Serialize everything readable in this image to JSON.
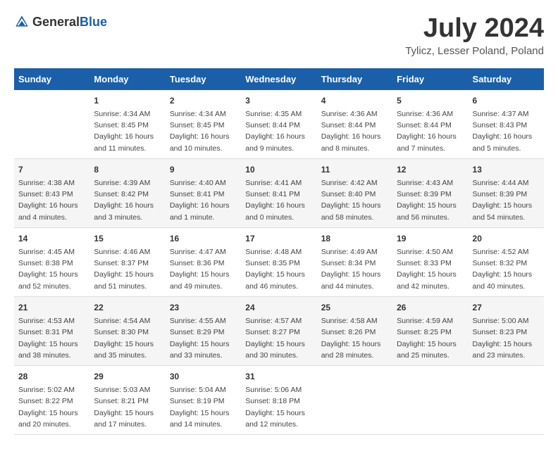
{
  "header": {
    "logo_general": "General",
    "logo_blue": "Blue",
    "month": "July 2024",
    "location": "Tylicz, Lesser Poland, Poland"
  },
  "weekdays": [
    "Sunday",
    "Monday",
    "Tuesday",
    "Wednesday",
    "Thursday",
    "Friday",
    "Saturday"
  ],
  "weeks": [
    [
      {
        "day": "",
        "sunrise": "",
        "sunset": "",
        "daylight": ""
      },
      {
        "day": "1",
        "sunrise": "Sunrise: 4:34 AM",
        "sunset": "Sunset: 8:45 PM",
        "daylight": "Daylight: 16 hours and 11 minutes."
      },
      {
        "day": "2",
        "sunrise": "Sunrise: 4:34 AM",
        "sunset": "Sunset: 8:45 PM",
        "daylight": "Daylight: 16 hours and 10 minutes."
      },
      {
        "day": "3",
        "sunrise": "Sunrise: 4:35 AM",
        "sunset": "Sunset: 8:44 PM",
        "daylight": "Daylight: 16 hours and 9 minutes."
      },
      {
        "day": "4",
        "sunrise": "Sunrise: 4:36 AM",
        "sunset": "Sunset: 8:44 PM",
        "daylight": "Daylight: 16 hours and 8 minutes."
      },
      {
        "day": "5",
        "sunrise": "Sunrise: 4:36 AM",
        "sunset": "Sunset: 8:44 PM",
        "daylight": "Daylight: 16 hours and 7 minutes."
      },
      {
        "day": "6",
        "sunrise": "Sunrise: 4:37 AM",
        "sunset": "Sunset: 8:43 PM",
        "daylight": "Daylight: 16 hours and 5 minutes."
      }
    ],
    [
      {
        "day": "7",
        "sunrise": "Sunrise: 4:38 AM",
        "sunset": "Sunset: 8:43 PM",
        "daylight": "Daylight: 16 hours and 4 minutes."
      },
      {
        "day": "8",
        "sunrise": "Sunrise: 4:39 AM",
        "sunset": "Sunset: 8:42 PM",
        "daylight": "Daylight: 16 hours and 3 minutes."
      },
      {
        "day": "9",
        "sunrise": "Sunrise: 4:40 AM",
        "sunset": "Sunset: 8:41 PM",
        "daylight": "Daylight: 16 hours and 1 minute."
      },
      {
        "day": "10",
        "sunrise": "Sunrise: 4:41 AM",
        "sunset": "Sunset: 8:41 PM",
        "daylight": "Daylight: 16 hours and 0 minutes."
      },
      {
        "day": "11",
        "sunrise": "Sunrise: 4:42 AM",
        "sunset": "Sunset: 8:40 PM",
        "daylight": "Daylight: 15 hours and 58 minutes."
      },
      {
        "day": "12",
        "sunrise": "Sunrise: 4:43 AM",
        "sunset": "Sunset: 8:39 PM",
        "daylight": "Daylight: 15 hours and 56 minutes."
      },
      {
        "day": "13",
        "sunrise": "Sunrise: 4:44 AM",
        "sunset": "Sunset: 8:39 PM",
        "daylight": "Daylight: 15 hours and 54 minutes."
      }
    ],
    [
      {
        "day": "14",
        "sunrise": "Sunrise: 4:45 AM",
        "sunset": "Sunset: 8:38 PM",
        "daylight": "Daylight: 15 hours and 52 minutes."
      },
      {
        "day": "15",
        "sunrise": "Sunrise: 4:46 AM",
        "sunset": "Sunset: 8:37 PM",
        "daylight": "Daylight: 15 hours and 51 minutes."
      },
      {
        "day": "16",
        "sunrise": "Sunrise: 4:47 AM",
        "sunset": "Sunset: 8:36 PM",
        "daylight": "Daylight: 15 hours and 49 minutes."
      },
      {
        "day": "17",
        "sunrise": "Sunrise: 4:48 AM",
        "sunset": "Sunset: 8:35 PM",
        "daylight": "Daylight: 15 hours and 46 minutes."
      },
      {
        "day": "18",
        "sunrise": "Sunrise: 4:49 AM",
        "sunset": "Sunset: 8:34 PM",
        "daylight": "Daylight: 15 hours and 44 minutes."
      },
      {
        "day": "19",
        "sunrise": "Sunrise: 4:50 AM",
        "sunset": "Sunset: 8:33 PM",
        "daylight": "Daylight: 15 hours and 42 minutes."
      },
      {
        "day": "20",
        "sunrise": "Sunrise: 4:52 AM",
        "sunset": "Sunset: 8:32 PM",
        "daylight": "Daylight: 15 hours and 40 minutes."
      }
    ],
    [
      {
        "day": "21",
        "sunrise": "Sunrise: 4:53 AM",
        "sunset": "Sunset: 8:31 PM",
        "daylight": "Daylight: 15 hours and 38 minutes."
      },
      {
        "day": "22",
        "sunrise": "Sunrise: 4:54 AM",
        "sunset": "Sunset: 8:30 PM",
        "daylight": "Daylight: 15 hours and 35 minutes."
      },
      {
        "day": "23",
        "sunrise": "Sunrise: 4:55 AM",
        "sunset": "Sunset: 8:29 PM",
        "daylight": "Daylight: 15 hours and 33 minutes."
      },
      {
        "day": "24",
        "sunrise": "Sunrise: 4:57 AM",
        "sunset": "Sunset: 8:27 PM",
        "daylight": "Daylight: 15 hours and 30 minutes."
      },
      {
        "day": "25",
        "sunrise": "Sunrise: 4:58 AM",
        "sunset": "Sunset: 8:26 PM",
        "daylight": "Daylight: 15 hours and 28 minutes."
      },
      {
        "day": "26",
        "sunrise": "Sunrise: 4:59 AM",
        "sunset": "Sunset: 8:25 PM",
        "daylight": "Daylight: 15 hours and 25 minutes."
      },
      {
        "day": "27",
        "sunrise": "Sunrise: 5:00 AM",
        "sunset": "Sunset: 8:23 PM",
        "daylight": "Daylight: 15 hours and 23 minutes."
      }
    ],
    [
      {
        "day": "28",
        "sunrise": "Sunrise: 5:02 AM",
        "sunset": "Sunset: 8:22 PM",
        "daylight": "Daylight: 15 hours and 20 minutes."
      },
      {
        "day": "29",
        "sunrise": "Sunrise: 5:03 AM",
        "sunset": "Sunset: 8:21 PM",
        "daylight": "Daylight: 15 hours and 17 minutes."
      },
      {
        "day": "30",
        "sunrise": "Sunrise: 5:04 AM",
        "sunset": "Sunset: 8:19 PM",
        "daylight": "Daylight: 15 hours and 14 minutes."
      },
      {
        "day": "31",
        "sunrise": "Sunrise: 5:06 AM",
        "sunset": "Sunset: 8:18 PM",
        "daylight": "Daylight: 15 hours and 12 minutes."
      },
      {
        "day": "",
        "sunrise": "",
        "sunset": "",
        "daylight": ""
      },
      {
        "day": "",
        "sunrise": "",
        "sunset": "",
        "daylight": ""
      },
      {
        "day": "",
        "sunrise": "",
        "sunset": "",
        "daylight": ""
      }
    ]
  ]
}
